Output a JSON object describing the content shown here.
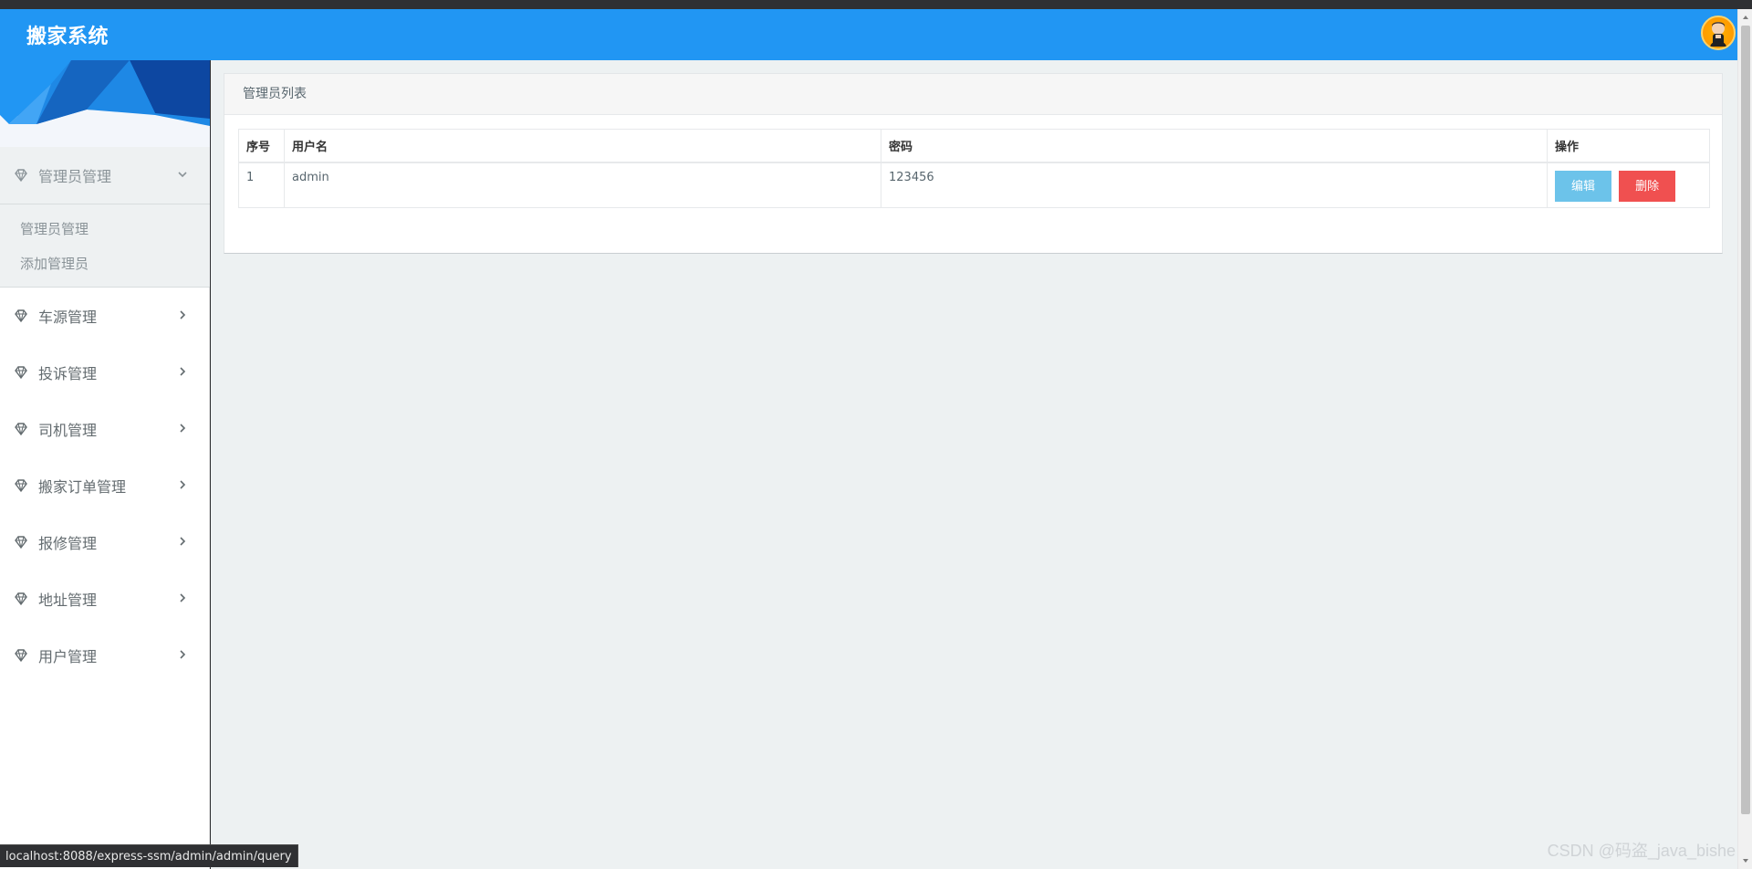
{
  "header": {
    "brand": "搬家系统",
    "avatar_icon": "user-avatar-icon"
  },
  "sidebar": {
    "active_section": "管理员管理",
    "submenu": [
      {
        "label": "管理员管理"
      },
      {
        "label": "添加管理员"
      }
    ],
    "items": [
      {
        "label": "车源管理"
      },
      {
        "label": "投诉管理"
      },
      {
        "label": "司机管理"
      },
      {
        "label": "搬家订单管理"
      },
      {
        "label": "报修管理"
      },
      {
        "label": "地址管理"
      },
      {
        "label": "用户管理"
      }
    ]
  },
  "panel": {
    "title": "管理员列表",
    "table": {
      "headers": [
        "序号",
        "用户名",
        "密码",
        "操作"
      ],
      "rows": [
        {
          "index": "1",
          "username": "admin",
          "password": "123456",
          "edit_label": "编辑",
          "delete_label": "删除"
        }
      ]
    }
  },
  "status": {
    "url": "localhost:8088/express-ssm/admin/admin/query"
  },
  "watermark": "CSDN @码盗_java_bishe",
  "colors": {
    "header": "#2196f3",
    "content_bg": "#edf1f2",
    "edit_button": "#6cc3ea",
    "delete_button": "#f05050"
  }
}
